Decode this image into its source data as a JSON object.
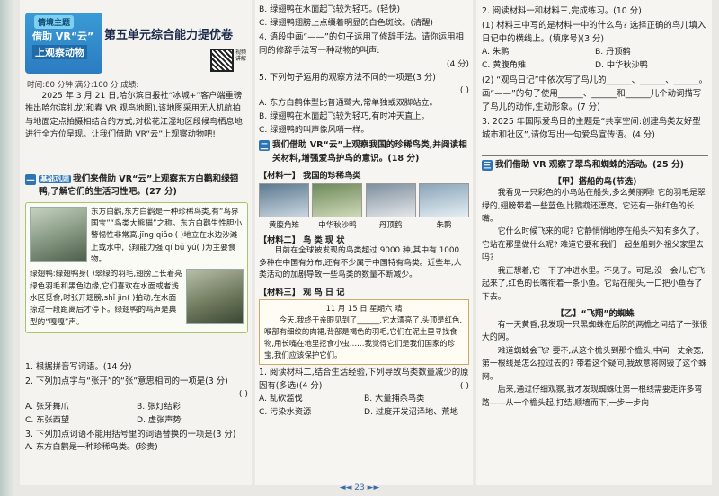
{
  "header": {
    "tag": "情境主题",
    "line1": "借助 VR“云”",
    "line2": "上观察动物",
    "title": "第五单元综合能力提优卷",
    "info": "时间:80 分钟   满分:100 分   成绩:",
    "qr_text": "视频讲解"
  },
  "intro": "2025 年 3 月 21 日,哈尔滨日报社“冰城+”客户端重磅推出哈尔滨扎龙(和春 VR 观鸟地图),该地图采用无人机航拍与地面定点拍摄相结合的方式,对松花江湿地区段候鸟栖息地进行全方位呈现。让我们借助 VR“云”上观察动物吧!",
  "sec1": {
    "num": "一",
    "title": "我们来借助 VR“云”上观察东方白鹳和绿翅鸭,了解它们的生活习性吧。(27 分)",
    "basic_tag": "基础巩固",
    "card1": "东方白鹳,东方白鹳是一种珍稀鸟类,有“鸟界国宝”“鸟类大熊猫”之称。东方白鹳生性胆小警惕性非常高,jīng qiǎo ( )地立在水边沙滩上或水中,飞翔能力强,qí bǔ yú( )为主要食物。",
    "card2": "绿翅鸭:绿翅鸭身( )翠绿的羽毛,翅膀上长着亮绿色羽毛和黑色边缘,它们喜欢在水面或者浅水区觅食,时张开翅膀,shǐ jìn( )拍动,在水面掠过一段距离后才停下。绿翅鸭的鸣声是典型的“嘎嘎”声。"
  },
  "qs_left": [
    {
      "q": "1. 根据拼音写词语。(14 分)"
    },
    {
      "q": "2. 下列加点字与“张开”的“张”意思相同的一项是(3 分)",
      "bracket": "(       )",
      "opts": [
        "A. 张牙舞爪",
        "B. 张灯结彩",
        "C. 东张西望",
        "D. 虚张声势"
      ]
    },
    {
      "q": "3. 下列加点词语不能用括号里的词语替换的一项是(3 分)",
      "bracket": "(       )",
      "opts": [
        "A. 东方白鹳是一种珍稀鸟类。(珍贵)"
      ]
    }
  ],
  "qs_mid_top": [
    {
      "opts": [
        "B. 绿翅鸭在水面起飞较为轻巧。(轻快)",
        "C. 绿翅鸭翅膀上点缀着明显的白色斑纹。(清醒)"
      ]
    },
    {
      "q": "4. 语段中画“——”的句子运用了修辞手法。请你运用相同的修辞手法写一种动物的叫声:",
      "tail": "(4 分)"
    },
    {
      "q": "5. 下列句子运用的观察方法不同的一项是(3 分)",
      "bracket": "(       )",
      "opts": [
        "A. 东方白鹳体型比普通鹭大,常单独或双脚站立。",
        "B. 绿翅鸭在水面起飞较为轻巧,有时冲天直上。",
        "C. 绿翅鸭的叫声像风哨一样。"
      ]
    }
  ],
  "sec2": {
    "num": "二",
    "title": "我们借助 VR“云”上观察我国的珍稀鸟类,并阅读相关材料,增强爱鸟护鸟的意识。(18 分)",
    "mat1": "【材料一】   我国的珍稀鸟类",
    "birds": [
      "黄腹角雉",
      "中华秋沙鸭",
      "丹顶鹤",
      "朱鹮"
    ],
    "mat2": "【材料二】   鸟 类 现 状",
    "mat2_text": "目前在全球被发现的鸟类超过 9000 种,其中有 1000 多种在中国有分布,还有不少属于中国特有鸟类。近些年,人类活动的加剧导致一些鸟类的数量不断减少。",
    "mat3": "【材料三】   观 鸟 日 记",
    "diary_head": "11 月 15 日    星期六      晴",
    "diary": "今天,我终于亲眼见到了______,它太漂亮了,头顶是红色,喉部有细纹的肉裙,背部是褐色的羽毛,它们在泥土里寻找食物,用长嘴在地里挖食小虫……我觉得它们是我们国家的珍宝,我们应该保护它们。",
    "q1": "1. 阅读材料二,结合生活经验,下列导致鸟类数量减少的原因有(多选)(4 分)",
    "q1_bracket": "(       )",
    "q1_opts": [
      "A. 乱砍滥伐",
      "B. 大量捕杀鸟类",
      "C. 污染水资源",
      "D. 过度开发沼泽地、荒地"
    ]
  },
  "qs_right": {
    "q2": "2. 阅读材料一和材料三,完成练习。(10 分)",
    "q2_1": "(1) 材料三中写的是材料一中的什么鸟? 选择正确的鸟儿填入日记中的横线上。(填序号)(3 分)",
    "q2_1_opts": [
      "A. 朱鹮",
      "B. 丹顶鹤",
      "C. 黄腹角雉",
      "D. 中华秋沙鸭"
    ],
    "q2_2": "(2) “观鸟日记”中依次写了鸟儿的______、______、______。画“——”的句子使用______、______和______儿个动词描写了鸟儿的动作,生动形象。(7 分)",
    "q3": "3. 2025 年国际爱鸟日的主题是“共享空间:创建鸟类友好型城市和社区”,请你写出一句爱鸟宣传语。(4 分)"
  },
  "sec3": {
    "num": "三",
    "title": "我们借助 VR 观察了翠鸟和蜘蛛的活动。(25 分)",
    "sub1": "【甲】搭船的鸟(节选)",
    "para1": "我看见一只彩色的小鸟站在船头,多么美丽啊! 它的羽毛是翠绿的,翅膀带着一些蓝色,比鹦鹉还漂亮。它还有一张红色的长嘴。",
    "para2": "它什么时候飞来的呢? 它静悄悄地停在船头不知有多久了。它站在那里做什么呢? 难道它要和我们一起坐船到外祖父家里去吗?",
    "para3": "我正想着,它一下子冲进水里。不见了。可是,没一会儿,它飞起来了,红色的长嘴衔着一条小鱼。它站在船头,一口把小鱼吞了下去。",
    "sub2": "【乙】“飞翔”的蜘蛛",
    "para4": "有一天黄昏,我发现一只黑蜘蛛在后院的两檐之间结了一张很大的网。",
    "para5": "难道蜘蛛会飞? 要不,从这个檐头到那个檐头,中间一丈余宽,第一根线是怎么拉过去的? 带着这个疑问,我故意将网毁了这个蛛网。",
    "para6": "后来,通过仔细观察,我才发现蜘蛛吐第一根线需要走许多弯路——从一个檐头起,打结,顺墙而下,一步一步向"
  },
  "footer": "◄◄ 23 ►►"
}
